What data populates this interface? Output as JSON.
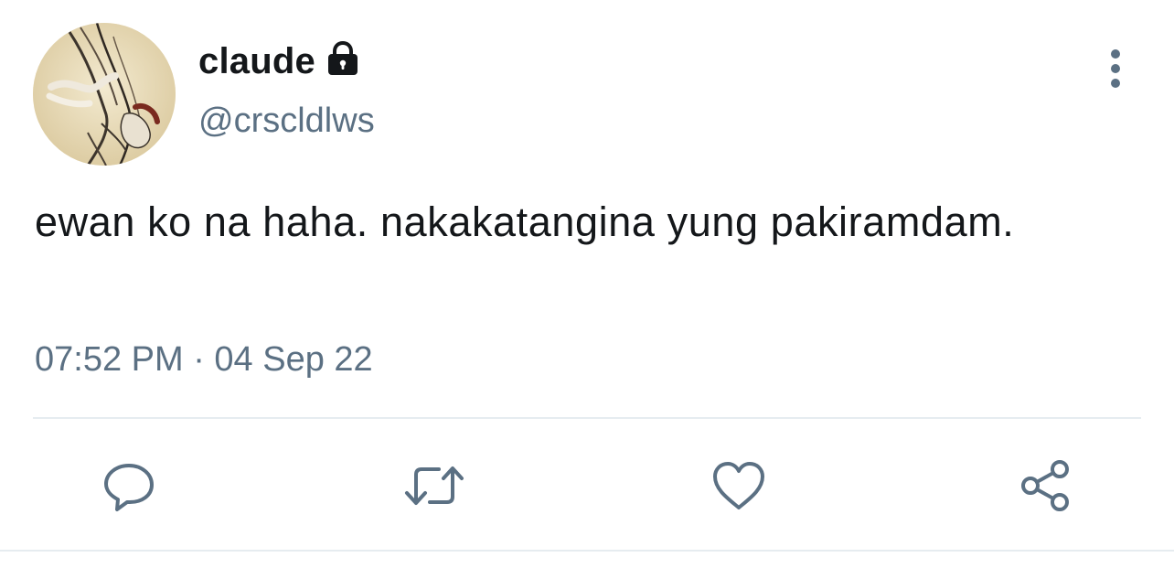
{
  "tweet": {
    "author": {
      "display_name": "claude",
      "handle": "@crscldlws",
      "protected_icon": "lock-icon",
      "avatar": "avatar-illustration"
    },
    "text": "ewan ko na haha. nakakatangina yung pakiramdam.",
    "timestamp": "07:52 PM · 04 Sep 22"
  },
  "actions": [
    {
      "name": "reply",
      "icon": "comment-icon"
    },
    {
      "name": "retweet",
      "icon": "retweet-icon"
    },
    {
      "name": "like",
      "icon": "heart-icon"
    },
    {
      "name": "share",
      "icon": "share-icon"
    }
  ],
  "menu": {
    "icon": "more-vertical-icon"
  },
  "colors": {
    "primary_text": "#14171a",
    "secondary_text": "#5b7083",
    "icon": "#5b7083",
    "divider": "#e6ecf0"
  }
}
